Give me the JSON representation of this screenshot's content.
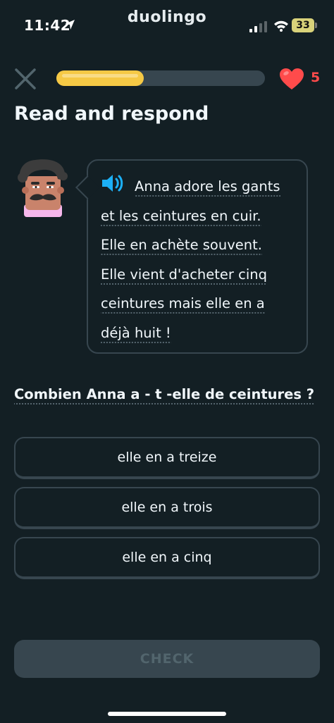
{
  "status_bar": {
    "time": "11:42",
    "app_name": "duolingo",
    "battery": "33"
  },
  "header": {
    "progress_fraction": 0.42,
    "hearts": "5",
    "progress_color": "#f6c945",
    "heart_color": "#ff4b4b"
  },
  "lesson": {
    "title": "Read and respond",
    "passage_lines": [
      "Anna adore les gants",
      "et les ceintures en cuir.",
      "Elle en achète souvent.",
      "Elle vient d'acheter cinq",
      "ceintures mais elle en  a",
      "déjà huit !"
    ],
    "question": "Combien Anna  a - t -elle de ceintures ?",
    "options": [
      "elle en a treize",
      "elle en a trois",
      "elle en a cinq"
    ],
    "check_label": "CHECK"
  },
  "icons": {
    "close": "close-icon",
    "heart": "heart-icon",
    "speaker": "speaker-icon"
  }
}
